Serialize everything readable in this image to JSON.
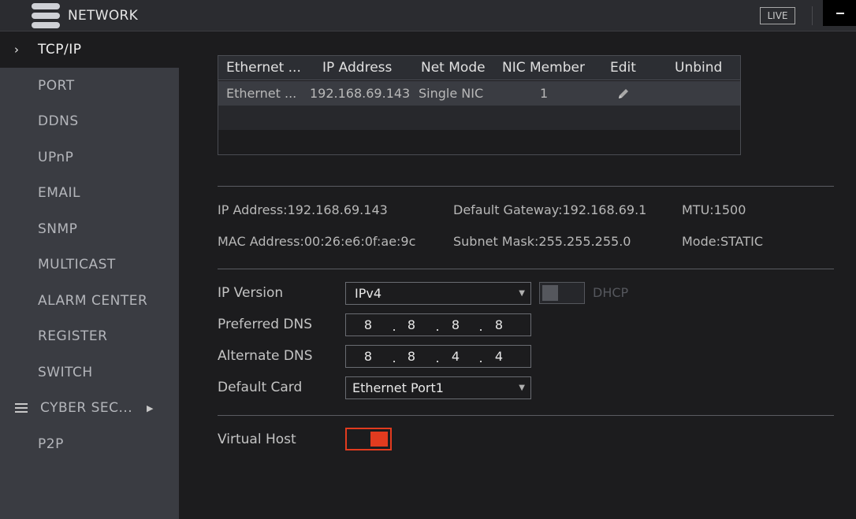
{
  "header": {
    "title": "NETWORK",
    "live_label": "LIVE"
  },
  "sidebar": {
    "items": [
      {
        "label": "TCP/IP"
      },
      {
        "label": "PORT"
      },
      {
        "label": "DDNS"
      },
      {
        "label": "UPnP"
      },
      {
        "label": "EMAIL"
      },
      {
        "label": "SNMP"
      },
      {
        "label": "MULTICAST"
      },
      {
        "label": "ALARM CENTER"
      },
      {
        "label": "REGISTER"
      },
      {
        "label": "SWITCH"
      },
      {
        "label": "CYBER SEC..."
      },
      {
        "label": "P2P"
      }
    ]
  },
  "nic_table": {
    "columns": [
      "Ethernet ...",
      "IP Address",
      "Net Mode",
      "NIC Member",
      "Edit",
      "Unbind"
    ],
    "rows": [
      {
        "ethernet": "Ethernet ...",
        "ip": "192.168.69.143",
        "mode": "Single NIC",
        "member": "1"
      }
    ]
  },
  "info": {
    "ip_address": "IP Address:192.168.69.143",
    "gateway": "Default Gateway:192.168.69.1",
    "mtu": "MTU:1500",
    "mac": "MAC Address:00:26:e6:0f:ae:9c",
    "subnet": "Subnet Mask:255.255.255.0",
    "mode": "Mode:STATIC"
  },
  "form": {
    "ip_version_label": "IP Version",
    "ip_version_value": "IPv4",
    "dhcp_label": "DHCP",
    "preferred_dns_label": "Preferred DNS",
    "preferred_dns": [
      "8",
      "8",
      "8",
      "8"
    ],
    "alternate_dns_label": "Alternate DNS",
    "alternate_dns": [
      "8",
      "8",
      "4",
      "4"
    ],
    "default_card_label": "Default Card",
    "default_card_value": "Ethernet Port1",
    "virtual_host_label": "Virtual Host"
  },
  "colors": {
    "accent": "#e23b1f",
    "sidebar_bg": "#3a3c42",
    "page_bg": "#1c1c1e"
  }
}
